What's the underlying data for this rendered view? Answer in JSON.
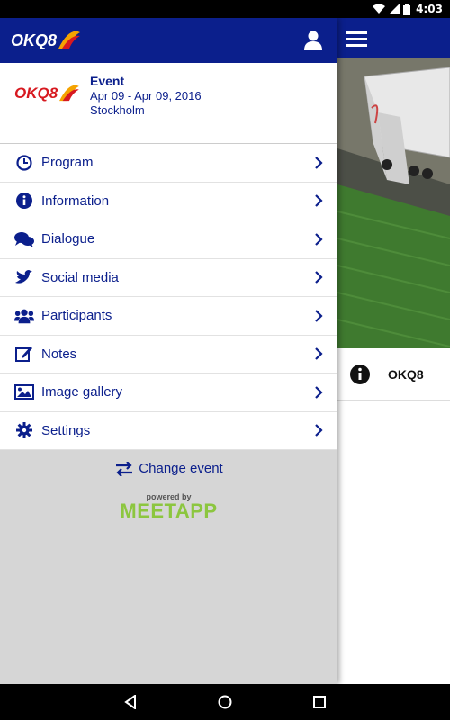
{
  "status_bar": {
    "time": "4:03"
  },
  "brand": {
    "logo_text": "OKQ8",
    "colors": {
      "navy": "#0b1f8c",
      "accent": "#f5a300",
      "red": "#d71920",
      "meetapp_green": "#8cc63f"
    }
  },
  "drawer": {
    "event": {
      "title": "Event",
      "dates": "Apr 09 - Apr 09, 2016",
      "location": "Stockholm"
    },
    "menu": [
      {
        "label": "Program",
        "icon": "clock-icon"
      },
      {
        "label": "Information",
        "icon": "info-icon"
      },
      {
        "label": "Dialogue",
        "icon": "chat-bubbles-icon"
      },
      {
        "label": "Social media",
        "icon": "twitter-bird-icon"
      },
      {
        "label": "Participants",
        "icon": "people-icon"
      },
      {
        "label": "Notes",
        "icon": "edit-note-icon"
      },
      {
        "label": "Image gallery",
        "icon": "image-icon"
      },
      {
        "label": "Settings",
        "icon": "gear-icon"
      }
    ],
    "change_event_label": "Change event",
    "powered_by": "powered by",
    "meetapp": "MEETAPP"
  },
  "main": {
    "info_row_label": "OKQ8"
  }
}
